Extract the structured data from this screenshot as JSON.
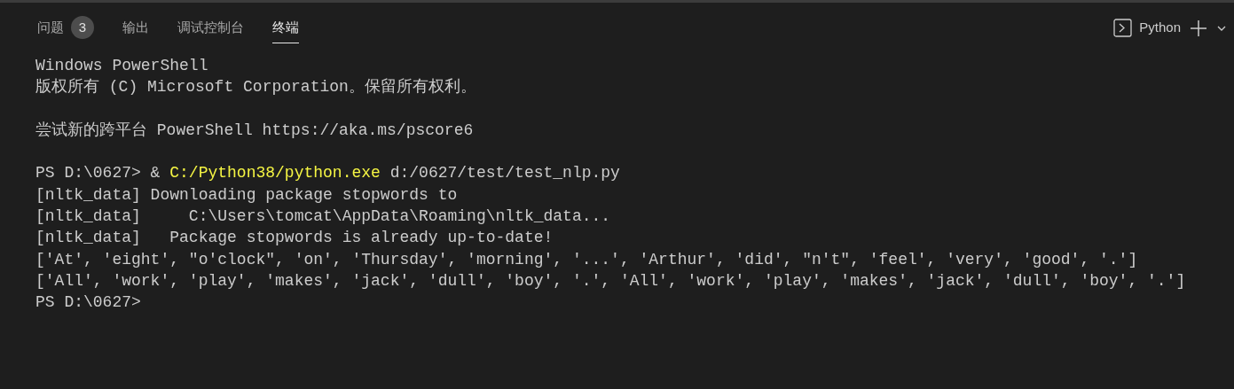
{
  "tabs": [
    {
      "label": "问题",
      "badge": "3",
      "selected": false
    },
    {
      "label": "输出",
      "selected": false
    },
    {
      "label": "调试控制台",
      "selected": false
    },
    {
      "label": "终端",
      "selected": true
    }
  ],
  "terminal_picker": {
    "label": "Python"
  },
  "terminal": {
    "blocks": [
      [
        [
          {
            "text": "Windows PowerShell",
            "highlighted": false
          }
        ],
        [
          {
            "text": "版权所有 (C) Microsoft Corporation。保留所有权利。",
            "highlighted": false
          }
        ]
      ],
      [
        [
          {
            "text": "尝试新的跨平台 PowerShell https://aka.ms/pscore6",
            "highlighted": false
          }
        ]
      ],
      [
        [
          {
            "text": "PS D:\\0627> & ",
            "highlighted": false
          },
          {
            "text": "C:/Python38/python.exe",
            "highlighted": true
          },
          {
            "text": " d:/0627/test/test_nlp.py",
            "highlighted": false
          }
        ],
        [
          {
            "text": "[nltk_data] Downloading package stopwords to",
            "highlighted": false
          }
        ],
        [
          {
            "text": "[nltk_data]     C:\\Users\\tomcat\\AppData\\Roaming\\nltk_data...",
            "highlighted": false
          }
        ],
        [
          {
            "text": "[nltk_data]   Package stopwords is already up-to-date!",
            "highlighted": false
          }
        ],
        [
          {
            "text": "['At', 'eight', \"o'clock\", 'on', 'Thursday', 'morning', '...', 'Arthur', 'did', \"n't\", 'feel', 'very', 'good', '.']",
            "highlighted": false
          }
        ],
        [
          {
            "text": "['All', 'work', 'play', 'makes', 'jack', 'dull', 'boy', '.', 'All', 'work', 'play', 'makes', 'jack', 'dull', 'boy', '.']",
            "highlighted": false
          }
        ],
        [
          {
            "text": "PS D:\\0627>",
            "highlighted": false
          }
        ]
      ]
    ]
  }
}
